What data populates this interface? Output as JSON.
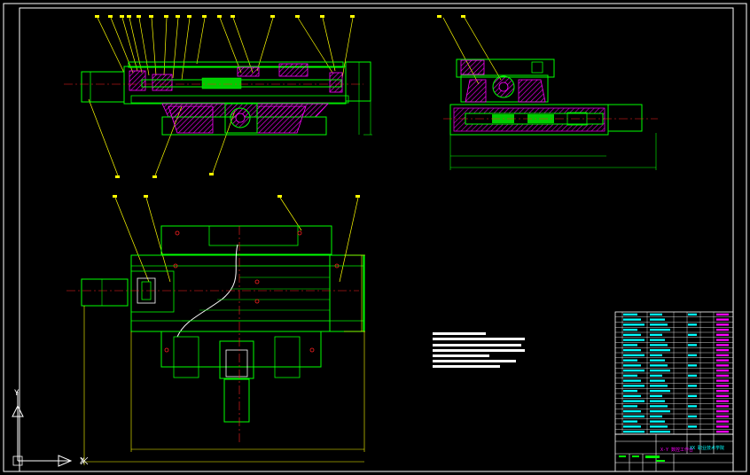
{
  "drawing": {
    "title_block": {
      "drawing_title": "X-Y 数控工作台",
      "institution": "XX 职业技术学院"
    },
    "ucs_icon": {
      "y_label": "Y",
      "x_label": "X"
    },
    "colors": {
      "background": "#000000",
      "outline": "#00ff00",
      "leader": "#ffff00",
      "hatch": "#ff00ff",
      "centerline": "#ff2020",
      "text": "#00ffff",
      "table_text": "#ff00ff",
      "white": "#ffffff"
    }
  }
}
